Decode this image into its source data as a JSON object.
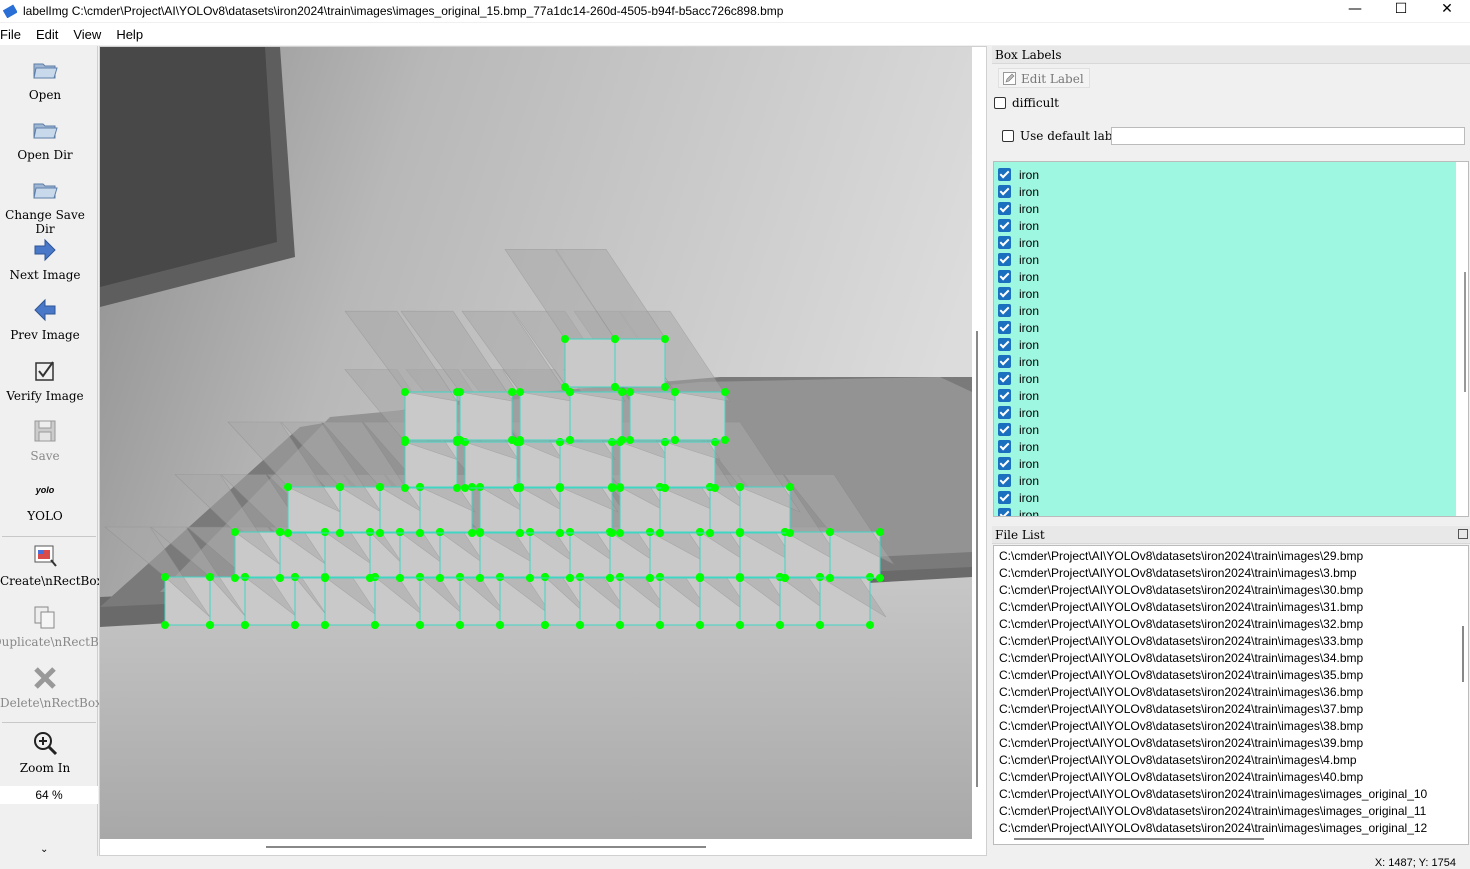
{
  "window": {
    "title": "labelImg C:\\cmder\\Project\\AI\\YOLOv8\\datasets\\iron2024\\train\\images\\images_original_15.bmp_77a1dc14-260d-4505-b94f-b5acc726c898.bmp",
    "minimize": "—",
    "maximize": "☐",
    "close": "✕"
  },
  "menu": {
    "file": "File",
    "edit": "Edit",
    "view": "View",
    "help": "Help"
  },
  "toolbar": {
    "open": "Open",
    "open_dir": "Open Dir",
    "change_save_dir": "Change Save Dir",
    "next_image": "Next Image",
    "prev_image": "Prev Image",
    "verify_image": "Verify Image",
    "save": "Save",
    "yolo_icon_text": "yolo",
    "yolo": "YOLO",
    "create_rectbox": "Create\\nRectBox",
    "duplicate_rectbox": "Duplicate\\nRectBox",
    "delete_rectbox": "Delete\\nRectBox",
    "zoom_in": "Zoom In",
    "zoom_level": "64 %",
    "expand": "⌄"
  },
  "box_labels": {
    "title": "Box Labels",
    "edit_label": "Edit Label",
    "difficult": "difficult",
    "use_default_label": "Use default labtel",
    "default_label_value": "",
    "items": [
      "iron",
      "iron",
      "iron",
      "iron",
      "iron",
      "iron",
      "iron",
      "iron",
      "iron",
      "iron",
      "iron",
      "iron",
      "iron",
      "iron",
      "iron",
      "iron",
      "iron",
      "iron",
      "iron",
      "iron",
      "iron"
    ]
  },
  "file_list": {
    "title": "File List",
    "items": [
      "C:\\cmder\\Project\\AI\\YOLOv8\\datasets\\iron2024\\train\\images\\29.bmp",
      "C:\\cmder\\Project\\AI\\YOLOv8\\datasets\\iron2024\\train\\images\\3.bmp",
      "C:\\cmder\\Project\\AI\\YOLOv8\\datasets\\iron2024\\train\\images\\30.bmp",
      "C:\\cmder\\Project\\AI\\YOLOv8\\datasets\\iron2024\\train\\images\\31.bmp",
      "C:\\cmder\\Project\\AI\\YOLOv8\\datasets\\iron2024\\train\\images\\32.bmp",
      "C:\\cmder\\Project\\AI\\YOLOv8\\datasets\\iron2024\\train\\images\\33.bmp",
      "C:\\cmder\\Project\\AI\\YOLOv8\\datasets\\iron2024\\train\\images\\34.bmp",
      "C:\\cmder\\Project\\AI\\YOLOv8\\datasets\\iron2024\\train\\images\\35.bmp",
      "C:\\cmder\\Project\\AI\\YOLOv8\\datasets\\iron2024\\train\\images\\36.bmp",
      "C:\\cmder\\Project\\AI\\YOLOv8\\datasets\\iron2024\\train\\images\\37.bmp",
      "C:\\cmder\\Project\\AI\\YOLOv8\\datasets\\iron2024\\train\\images\\38.bmp",
      "C:\\cmder\\Project\\AI\\YOLOv8\\datasets\\iron2024\\train\\images\\39.bmp",
      "C:\\cmder\\Project\\AI\\YOLOv8\\datasets\\iron2024\\train\\images\\4.bmp",
      "C:\\cmder\\Project\\AI\\YOLOv8\\datasets\\iron2024\\train\\images\\40.bmp",
      "C:\\cmder\\Project\\AI\\YOLOv8\\datasets\\iron2024\\train\\images\\images_original_10",
      "C:\\cmder\\Project\\AI\\YOLOv8\\datasets\\iron2024\\train\\images\\images_original_11",
      "C:\\cmder\\Project\\AI\\YOLOv8\\datasets\\iron2024\\train\\images\\images_original_12"
    ]
  },
  "status": {
    "coords": "X: 1487; Y: 1754"
  },
  "colors": {
    "label_list_bg": "#9ef7e0",
    "annotation_point": "#00ff00",
    "annotation_box": "#3fd6c4",
    "checkbox_checked": "#1b6fbf"
  }
}
